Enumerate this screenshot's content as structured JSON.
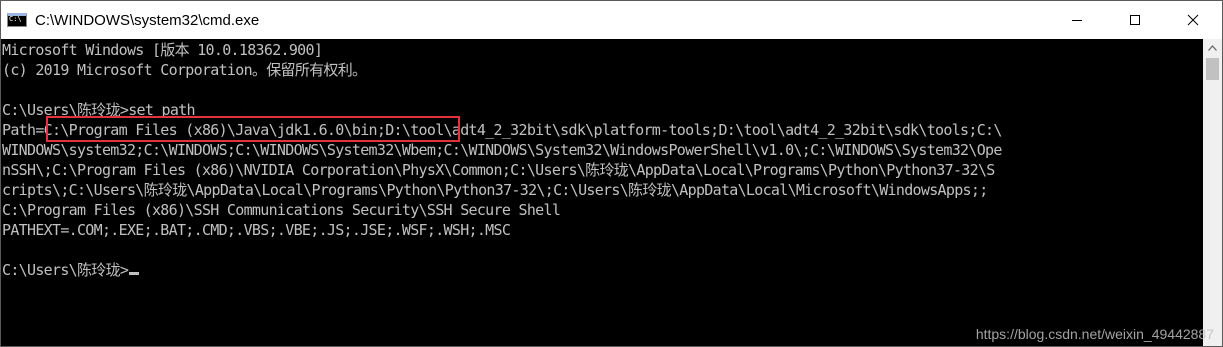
{
  "window": {
    "title": "C:\\WINDOWS\\system32\\cmd.exe",
    "icon": "cmd-icon"
  },
  "caption_buttons": {
    "minimize_icon": "minimize-icon",
    "maximize_icon": "maximize-icon",
    "close_icon": "close-icon"
  },
  "console": {
    "lines": [
      "Microsoft Windows [版本 10.0.18362.900]",
      "(c) 2019 Microsoft Corporation。保留所有权利。",
      "",
      "C:\\Users\\陈玲珑>set path",
      "Path=C:\\Program Files (x86)\\Java\\jdk1.6.0\\bin;D:\\tool\\adt4_2_32bit\\sdk\\platform-tools;D:\\tool\\adt4_2_32bit\\sdk\\tools;C:\\",
      "WINDOWS\\system32;C:\\WINDOWS;C:\\WINDOWS\\System32\\Wbem;C:\\WINDOWS\\System32\\WindowsPowerShell\\v1.0\\;C:\\WINDOWS\\System32\\Ope",
      "nSSH\\;C:\\Program Files (x86)\\NVIDIA Corporation\\PhysX\\Common;C:\\Users\\陈玲珑\\AppData\\Local\\Programs\\Python\\Python37-32\\S",
      "cripts\\;C:\\Users\\陈玲珑\\AppData\\Local\\Programs\\Python\\Python37-32\\;C:\\Users\\陈玲珑\\AppData\\Local\\Microsoft\\WindowsApps;;",
      "C:\\Program Files (x86)\\SSH Communications Security\\SSH Secure Shell",
      "PATHEXT=.COM;.EXE;.BAT;.CMD;.VBS;.VBE;.JS;.JSE;.WSF;.WSH;.MSC",
      "",
      "C:\\Users\\陈玲珑>"
    ]
  },
  "annotation": {
    "highlight_color": "#e0343a"
  },
  "watermark": "https://blog.csdn.net/weixin_49442887",
  "colors": {
    "console_bg": "#000000",
    "console_text": "#c0c0c0",
    "titlebar_bg": "#ffffff"
  }
}
